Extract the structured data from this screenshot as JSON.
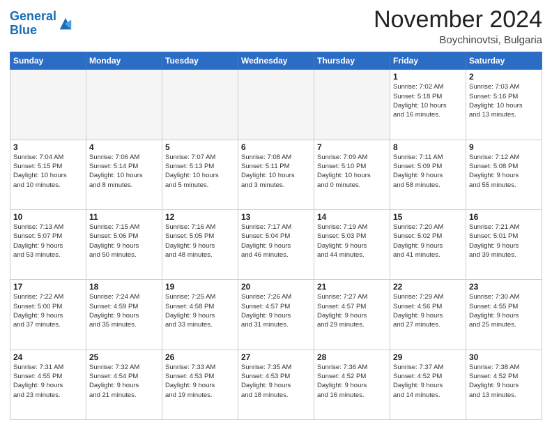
{
  "header": {
    "logo_line1": "General",
    "logo_line2": "Blue",
    "month": "November 2024",
    "location": "Boychinovtsi, Bulgaria"
  },
  "weekdays": [
    "Sunday",
    "Monday",
    "Tuesday",
    "Wednesday",
    "Thursday",
    "Friday",
    "Saturday"
  ],
  "weeks": [
    [
      {
        "day": "",
        "info": "",
        "empty": true
      },
      {
        "day": "",
        "info": "",
        "empty": true
      },
      {
        "day": "",
        "info": "",
        "empty": true
      },
      {
        "day": "",
        "info": "",
        "empty": true
      },
      {
        "day": "",
        "info": "",
        "empty": true
      },
      {
        "day": "1",
        "info": "Sunrise: 7:02 AM\nSunset: 5:18 PM\nDaylight: 10 hours\nand 16 minutes.",
        "empty": false
      },
      {
        "day": "2",
        "info": "Sunrise: 7:03 AM\nSunset: 5:16 PM\nDaylight: 10 hours\nand 13 minutes.",
        "empty": false
      }
    ],
    [
      {
        "day": "3",
        "info": "Sunrise: 7:04 AM\nSunset: 5:15 PM\nDaylight: 10 hours\nand 10 minutes.",
        "empty": false
      },
      {
        "day": "4",
        "info": "Sunrise: 7:06 AM\nSunset: 5:14 PM\nDaylight: 10 hours\nand 8 minutes.",
        "empty": false
      },
      {
        "day": "5",
        "info": "Sunrise: 7:07 AM\nSunset: 5:13 PM\nDaylight: 10 hours\nand 5 minutes.",
        "empty": false
      },
      {
        "day": "6",
        "info": "Sunrise: 7:08 AM\nSunset: 5:11 PM\nDaylight: 10 hours\nand 3 minutes.",
        "empty": false
      },
      {
        "day": "7",
        "info": "Sunrise: 7:09 AM\nSunset: 5:10 PM\nDaylight: 10 hours\nand 0 minutes.",
        "empty": false
      },
      {
        "day": "8",
        "info": "Sunrise: 7:11 AM\nSunset: 5:09 PM\nDaylight: 9 hours\nand 58 minutes.",
        "empty": false
      },
      {
        "day": "9",
        "info": "Sunrise: 7:12 AM\nSunset: 5:08 PM\nDaylight: 9 hours\nand 55 minutes.",
        "empty": false
      }
    ],
    [
      {
        "day": "10",
        "info": "Sunrise: 7:13 AM\nSunset: 5:07 PM\nDaylight: 9 hours\nand 53 minutes.",
        "empty": false
      },
      {
        "day": "11",
        "info": "Sunrise: 7:15 AM\nSunset: 5:06 PM\nDaylight: 9 hours\nand 50 minutes.",
        "empty": false
      },
      {
        "day": "12",
        "info": "Sunrise: 7:16 AM\nSunset: 5:05 PM\nDaylight: 9 hours\nand 48 minutes.",
        "empty": false
      },
      {
        "day": "13",
        "info": "Sunrise: 7:17 AM\nSunset: 5:04 PM\nDaylight: 9 hours\nand 46 minutes.",
        "empty": false
      },
      {
        "day": "14",
        "info": "Sunrise: 7:19 AM\nSunset: 5:03 PM\nDaylight: 9 hours\nand 44 minutes.",
        "empty": false
      },
      {
        "day": "15",
        "info": "Sunrise: 7:20 AM\nSunset: 5:02 PM\nDaylight: 9 hours\nand 41 minutes.",
        "empty": false
      },
      {
        "day": "16",
        "info": "Sunrise: 7:21 AM\nSunset: 5:01 PM\nDaylight: 9 hours\nand 39 minutes.",
        "empty": false
      }
    ],
    [
      {
        "day": "17",
        "info": "Sunrise: 7:22 AM\nSunset: 5:00 PM\nDaylight: 9 hours\nand 37 minutes.",
        "empty": false
      },
      {
        "day": "18",
        "info": "Sunrise: 7:24 AM\nSunset: 4:59 PM\nDaylight: 9 hours\nand 35 minutes.",
        "empty": false
      },
      {
        "day": "19",
        "info": "Sunrise: 7:25 AM\nSunset: 4:58 PM\nDaylight: 9 hours\nand 33 minutes.",
        "empty": false
      },
      {
        "day": "20",
        "info": "Sunrise: 7:26 AM\nSunset: 4:57 PM\nDaylight: 9 hours\nand 31 minutes.",
        "empty": false
      },
      {
        "day": "21",
        "info": "Sunrise: 7:27 AM\nSunset: 4:57 PM\nDaylight: 9 hours\nand 29 minutes.",
        "empty": false
      },
      {
        "day": "22",
        "info": "Sunrise: 7:29 AM\nSunset: 4:56 PM\nDaylight: 9 hours\nand 27 minutes.",
        "empty": false
      },
      {
        "day": "23",
        "info": "Sunrise: 7:30 AM\nSunset: 4:55 PM\nDaylight: 9 hours\nand 25 minutes.",
        "empty": false
      }
    ],
    [
      {
        "day": "24",
        "info": "Sunrise: 7:31 AM\nSunset: 4:55 PM\nDaylight: 9 hours\nand 23 minutes.",
        "empty": false
      },
      {
        "day": "25",
        "info": "Sunrise: 7:32 AM\nSunset: 4:54 PM\nDaylight: 9 hours\nand 21 minutes.",
        "empty": false
      },
      {
        "day": "26",
        "info": "Sunrise: 7:33 AM\nSunset: 4:53 PM\nDaylight: 9 hours\nand 19 minutes.",
        "empty": false
      },
      {
        "day": "27",
        "info": "Sunrise: 7:35 AM\nSunset: 4:53 PM\nDaylight: 9 hours\nand 18 minutes.",
        "empty": false
      },
      {
        "day": "28",
        "info": "Sunrise: 7:36 AM\nSunset: 4:52 PM\nDaylight: 9 hours\nand 16 minutes.",
        "empty": false
      },
      {
        "day": "29",
        "info": "Sunrise: 7:37 AM\nSunset: 4:52 PM\nDaylight: 9 hours\nand 14 minutes.",
        "empty": false
      },
      {
        "day": "30",
        "info": "Sunrise: 7:38 AM\nSunset: 4:52 PM\nDaylight: 9 hours\nand 13 minutes.",
        "empty": false
      }
    ]
  ]
}
